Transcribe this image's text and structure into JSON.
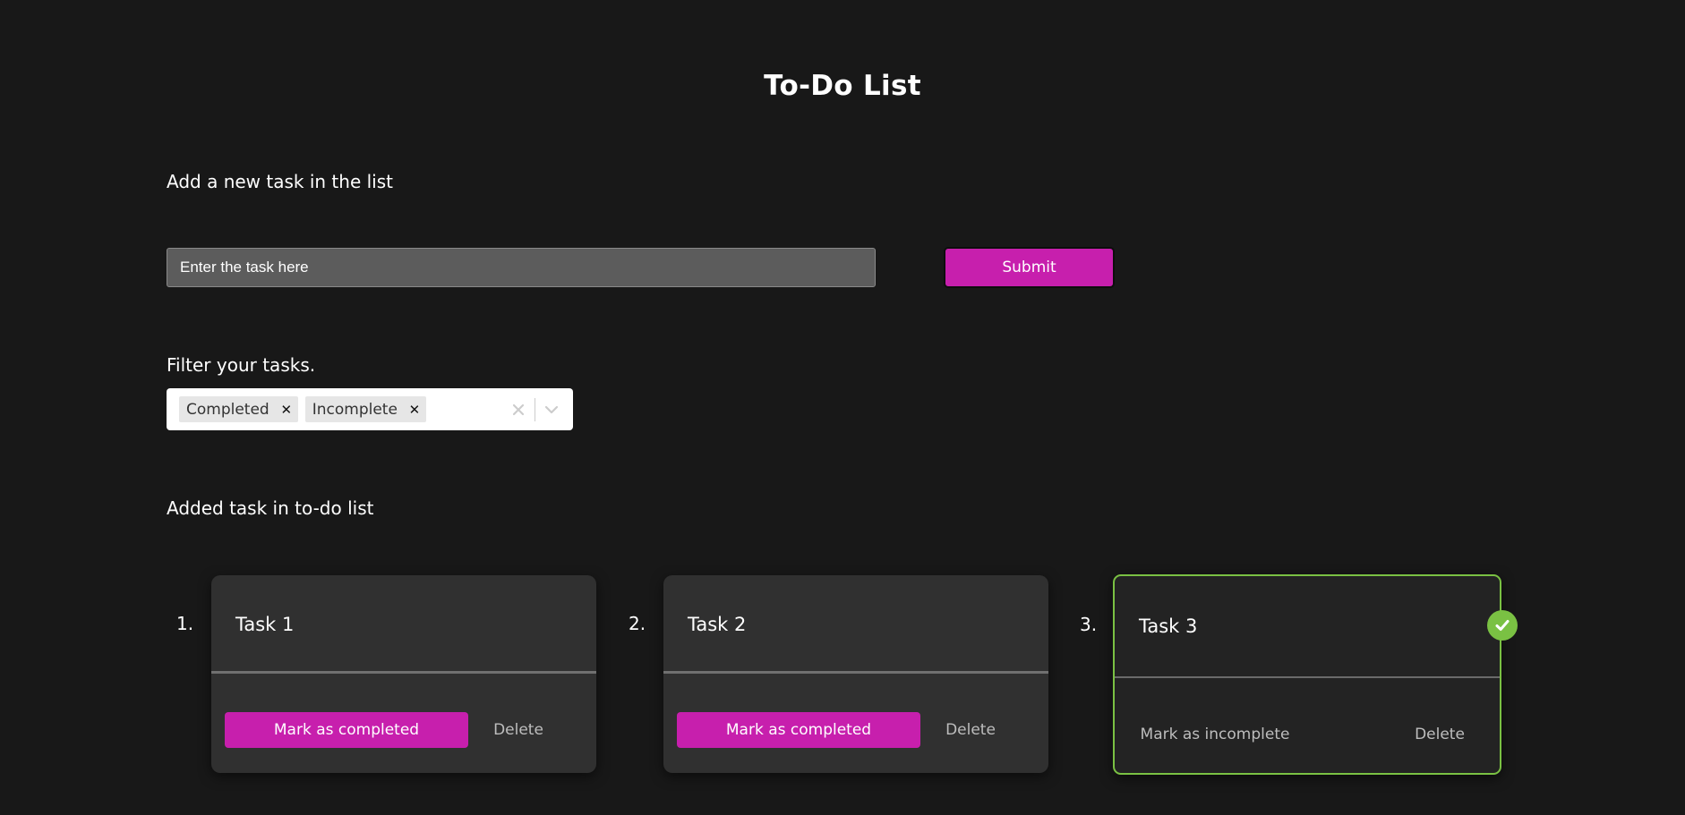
{
  "header": {
    "title": "To-Do List"
  },
  "add_task": {
    "label": "Add a new task in the list",
    "input_placeholder": "Enter the task here",
    "input_value": "",
    "submit_label": "Submit"
  },
  "filter": {
    "label": "Filter your tasks.",
    "selected": [
      {
        "label": "Completed",
        "remove_icon": "close-icon"
      },
      {
        "label": "Incomplete",
        "remove_icon": "close-icon"
      }
    ],
    "clear_icon": "close-icon",
    "dropdown_icon": "chevron-down-icon"
  },
  "task_list": {
    "label": "Added task in to-do list",
    "tasks": [
      {
        "number": "1.",
        "name": "Task 1",
        "completed": false,
        "action_label": "Mark as completed",
        "delete_label": "Delete"
      },
      {
        "number": "2.",
        "name": "Task 2",
        "completed": false,
        "action_label": "Mark as completed",
        "delete_label": "Delete"
      },
      {
        "number": "3.",
        "name": "Task 3",
        "completed": true,
        "action_label": "Mark as incomplete",
        "delete_label": "Delete",
        "status_icon": "check-circle-icon"
      }
    ]
  },
  "colors": {
    "background": "#181818",
    "accent": "#c71fad",
    "completed_border": "#7ac143",
    "card_background": "#303030",
    "input_background": "#5c5c5c"
  }
}
